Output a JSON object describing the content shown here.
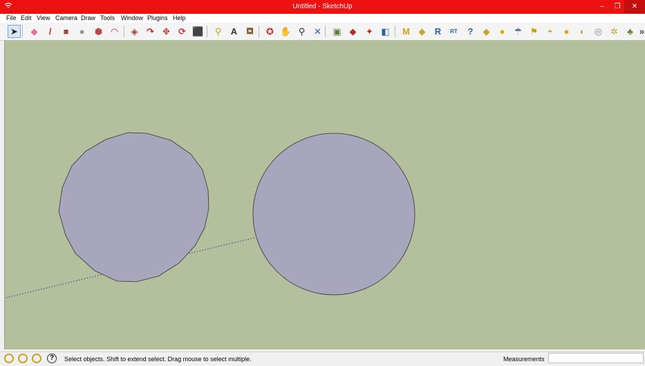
{
  "window": {
    "title": "Untitled - SketchUp",
    "minimize": "–",
    "restore": "❐",
    "close": "✕"
  },
  "menu": [
    "File",
    "Edit",
    "View",
    "Camera",
    "Draw",
    "Tools",
    "Window",
    "Plugins",
    "Help"
  ],
  "toolbar": {
    "tools": [
      {
        "name": "select-tool-icon",
        "glyph": "➤",
        "color": "#222222",
        "active": true
      },
      {
        "name": "eraser-tool-icon",
        "glyph": "◆",
        "color": "#e0709a"
      },
      {
        "name": "pencil-tool-icon",
        "glyph": "/",
        "color": "#c62828"
      },
      {
        "name": "rectangle-tool-icon",
        "glyph": "■",
        "color": "#a04b3a"
      },
      {
        "name": "circle-tool-icon",
        "glyph": "●",
        "color": "#8a9a7b"
      },
      {
        "name": "polygon-tool-icon",
        "glyph": "⬢",
        "color": "#b74b4b"
      },
      {
        "name": "arc-tool-icon",
        "glyph": "◠",
        "color": "#c62828"
      },
      {
        "name": "push-pull-tool-icon",
        "glyph": "◈",
        "color": "#b13a2b"
      },
      {
        "name": "follow-me-tool-icon",
        "glyph": "↷",
        "color": "#c62828"
      },
      {
        "name": "move-tool-icon",
        "glyph": "✥",
        "color": "#d32f2f"
      },
      {
        "name": "rotate-tool-icon",
        "glyph": "⟳",
        "color": "#d32f2f"
      },
      {
        "name": "scale-tool-icon",
        "glyph": "⬛",
        "color": "#a83224"
      },
      {
        "name": "tape-measure-tool-icon",
        "glyph": "⚲",
        "color": "#c9a227"
      },
      {
        "name": "text-tool-icon",
        "glyph": "A",
        "color": "#333333"
      },
      {
        "name": "paint-bucket-tool-icon",
        "glyph": "⛾",
        "color": "#7a5c2a"
      },
      {
        "name": "orbit-tool-icon",
        "glyph": "✪",
        "color": "#c62828"
      },
      {
        "name": "pan-tool-icon",
        "glyph": "✋",
        "color": "#666666"
      },
      {
        "name": "zoom-tool-icon",
        "glyph": "⚲",
        "color": "#333333"
      },
      {
        "name": "zoom-extents-tool-icon",
        "glyph": "✕",
        "color": "#2962a8"
      },
      {
        "name": "warehouse-icon",
        "glyph": "▣",
        "color": "#5a7a3a"
      },
      {
        "name": "share-model-icon",
        "glyph": "◆",
        "color": "#b03030"
      },
      {
        "name": "components-icon",
        "glyph": "✦",
        "color": "#c62828"
      },
      {
        "name": "extension-icon",
        "glyph": "◧",
        "color": "#2962a8"
      },
      {
        "name": "plugin-m-icon",
        "glyph": "M",
        "color": "#caa21a"
      },
      {
        "name": "plugin-tag-icon",
        "glyph": "◆",
        "color": "#c9a227"
      },
      {
        "name": "plugin-r-icon",
        "glyph": "R",
        "color": "#2962a8"
      },
      {
        "name": "plugin-rt-icon",
        "glyph": "RT",
        "color": "#2962a8"
      },
      {
        "name": "help-plugin-icon",
        "glyph": "?",
        "color": "#2962a8"
      },
      {
        "name": "plugin-label-icon",
        "glyph": "◆",
        "color": "#c9a227"
      },
      {
        "name": "sphere-icon",
        "glyph": "●",
        "color": "#e0a800"
      },
      {
        "name": "light-icon",
        "glyph": "☂",
        "color": "#5a7aa8"
      },
      {
        "name": "flag-icon",
        "glyph": "⚑",
        "color": "#d0a000"
      },
      {
        "name": "dome-icon",
        "glyph": "◓",
        "color": "#e0a800"
      },
      {
        "name": "ball-icon",
        "glyph": "●",
        "color": "#e0a800"
      },
      {
        "name": "spot-light-icon",
        "glyph": "◐",
        "color": "#c9a227"
      },
      {
        "name": "render-icon",
        "glyph": "◎",
        "color": "#888888"
      },
      {
        "name": "sun-icon",
        "glyph": "✲",
        "color": "#c9a227"
      },
      {
        "name": "tree-icon",
        "glyph": "♣",
        "color": "#5a8a2a"
      },
      {
        "name": "more-tools-icon",
        "glyph": "»",
        "color": "#444444"
      }
    ]
  },
  "status": {
    "text": "Select objects. Shift to extend select. Drag mouse to select multiple.",
    "measurements_label": "Measurements",
    "measurements_value": "",
    "help_glyph": "?"
  },
  "colors": {
    "titlebar": "#ee1111",
    "viewport_bg": "#b4bf9e",
    "face_fill": "#a7a6bc",
    "edge": "#333333",
    "axis_line": "#1f3a7a"
  }
}
